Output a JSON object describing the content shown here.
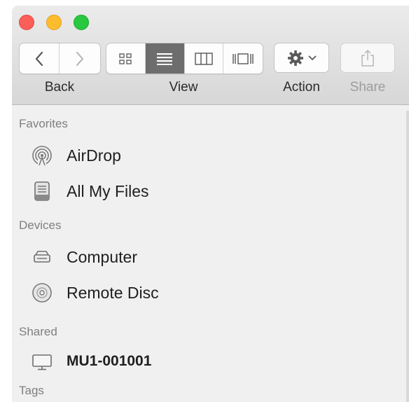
{
  "window": {
    "traffic_lights": {
      "close": "#fc5f57",
      "minimize": "#fdbc2e",
      "zoom": "#28c840"
    }
  },
  "toolbar": {
    "back_label": "Back",
    "view_label": "View",
    "action_label": "Action",
    "share_label": "Share",
    "view_modes": [
      "icon-view",
      "list-view",
      "column-view",
      "cover-flow-view"
    ],
    "active_view": "list-view"
  },
  "sidebar": {
    "favorites": {
      "header": "Favorites",
      "items": [
        {
          "label": "AirDrop",
          "icon": "airdrop-icon"
        },
        {
          "label": "All My Files",
          "icon": "all-my-files-icon"
        }
      ]
    },
    "devices": {
      "header": "Devices",
      "items": [
        {
          "label": "Computer",
          "icon": "computer-drive-icon"
        },
        {
          "label": "Remote Disc",
          "icon": "remote-disc-icon"
        }
      ]
    },
    "shared": {
      "header": "Shared",
      "items": [
        {
          "label": "MU1-001001",
          "icon": "monitor-icon"
        }
      ]
    },
    "tags": {
      "header": "Tags"
    }
  }
}
